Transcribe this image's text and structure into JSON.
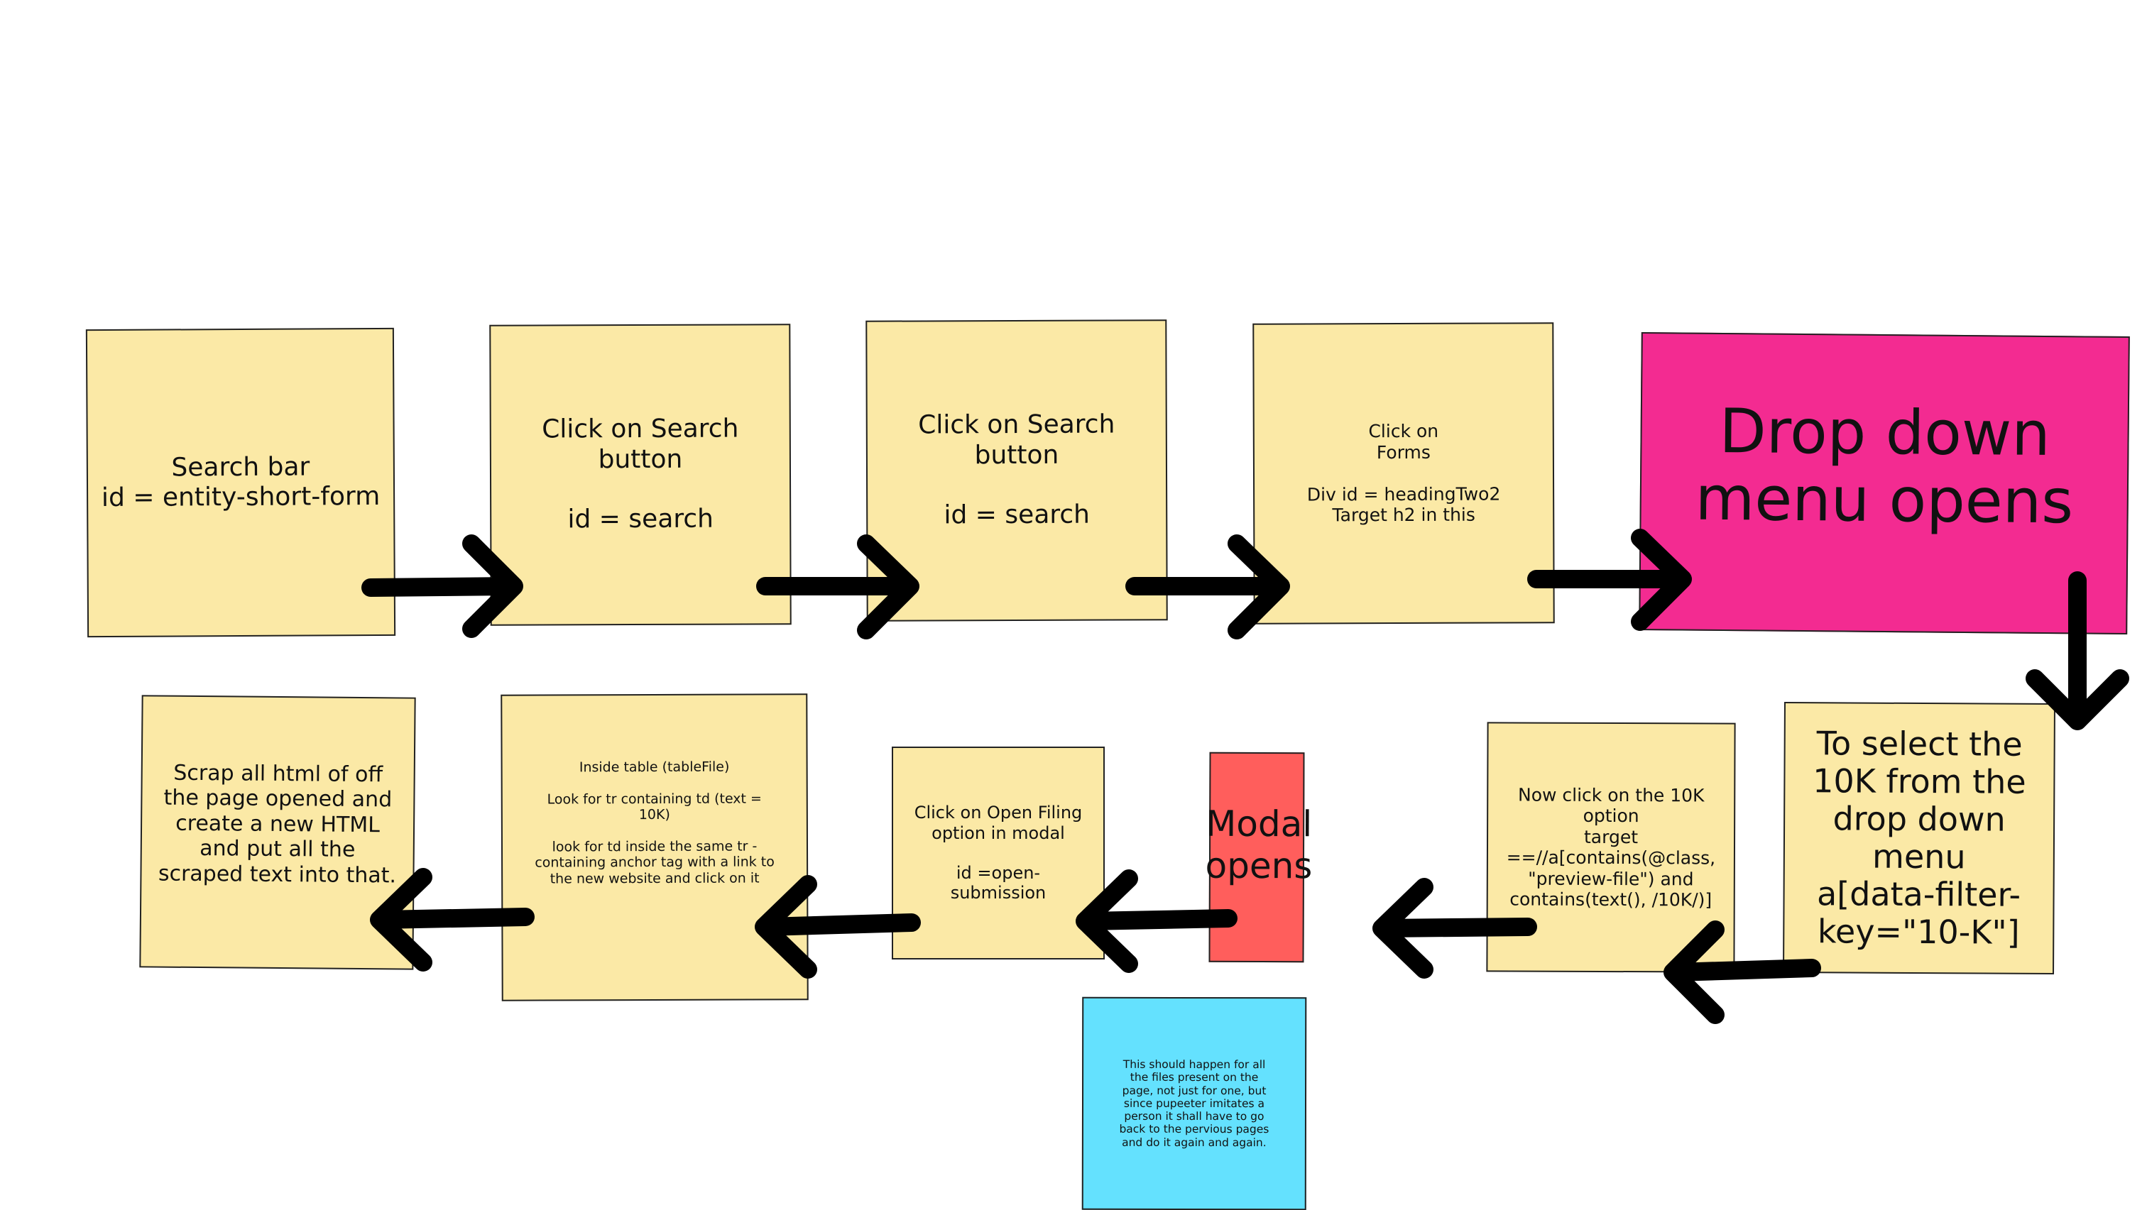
{
  "diagram": {
    "background": "#ffffff",
    "note_colors": {
      "yellow": "#fbe9a6",
      "magenta": "#f32b91",
      "red": "#ff5e5c",
      "cyan": "#64e1fe"
    },
    "arrow_color": "#000000",
    "notes": {
      "search_bar": "Search bar\nid = entity-short-form",
      "click_search_1": "Click on Search button\n\nid = search",
      "click_search_2": "Click on Search button\n\nid = search",
      "click_forms": "Click on\nForms\n\nDiv id  = headingTwo2\nTarget h2 in this",
      "dropdown": "Drop down\nmenu opens",
      "select_10k": "To select the\n10K from the\ndrop down\nmenu\na[data-filter-\nkey=\"10-K\"]",
      "ten_k_option": "Now click on the 10K\noption\ntarget\n==//a[contains(@class,\n\"preview-file\") and\ncontains(text(), /10K/)]",
      "modal": "Modal opens",
      "open_filing": "Click on Open Filing\noption in modal\n\nid  =open-\nsubmission",
      "inside_table": "Inside table (tableFile)\n\nLook for tr containing td (text =\n10K)\n\nlook for td inside the same tr -\ncontaining anchor tag with a link to\nthe new website and click on it",
      "scrap_html": "Scrap all html of off\nthe page opened and\ncreate a new HTML\nand put all the\nscraped text into that.",
      "repeat": "This should happen for all\nthe files present on the\npage, not just for one, but\nsince pupeeter imitates a\nperson it shall have to go\nback to the pervious pages\nand do it again and again."
    }
  }
}
